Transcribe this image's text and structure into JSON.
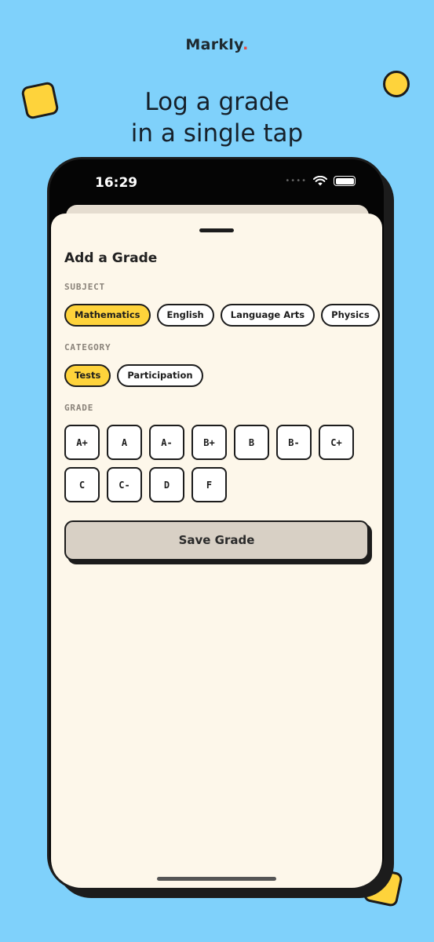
{
  "brand": {
    "name": "Markly",
    "dot": "."
  },
  "headline": {
    "line1": "Log a grade",
    "line2": "in a single tap"
  },
  "status_bar": {
    "time": "16:29",
    "signal": "••••"
  },
  "sheet": {
    "title": "Add a Grade",
    "subject": {
      "label": "SUBJECT",
      "options": [
        "Mathematics",
        "English",
        "Language Arts",
        "Physics"
      ],
      "selected": "Mathematics"
    },
    "category": {
      "label": "CATEGORY",
      "options": [
        "Tests",
        "Participation"
      ],
      "selected": "Tests"
    },
    "grade": {
      "label": "GRADE",
      "options": [
        "A+",
        "A",
        "A-",
        "B+",
        "B",
        "B-",
        "C+",
        "C",
        "C-",
        "D",
        "F"
      ]
    },
    "save_label": "Save Grade"
  },
  "colors": {
    "background": "#7fd1fb",
    "accent": "#fed33b",
    "sheet": "#fdf7ea",
    "save_button": "#d8d0c5",
    "brand_dot": "#e8483f"
  }
}
